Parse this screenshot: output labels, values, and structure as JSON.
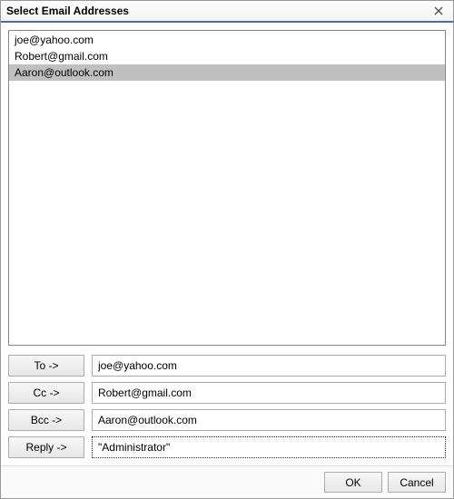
{
  "dialog": {
    "title": "Select Email Addresses"
  },
  "list": {
    "items": [
      {
        "text": "joe@yahoo.com",
        "selected": false
      },
      {
        "text": "Robert@gmail.com",
        "selected": false
      },
      {
        "text": "Aaron@outlook.com",
        "selected": true
      }
    ]
  },
  "fields": {
    "to": {
      "label": "To ->",
      "value": "joe@yahoo.com"
    },
    "cc": {
      "label": "Cc ->",
      "value": "Robert@gmail.com"
    },
    "bcc": {
      "label": "Bcc ->",
      "value": "Aaron@outlook.com"
    },
    "reply": {
      "label": "Reply ->",
      "value": "\"Administrator\""
    }
  },
  "buttons": {
    "ok": "OK",
    "cancel": "Cancel"
  }
}
